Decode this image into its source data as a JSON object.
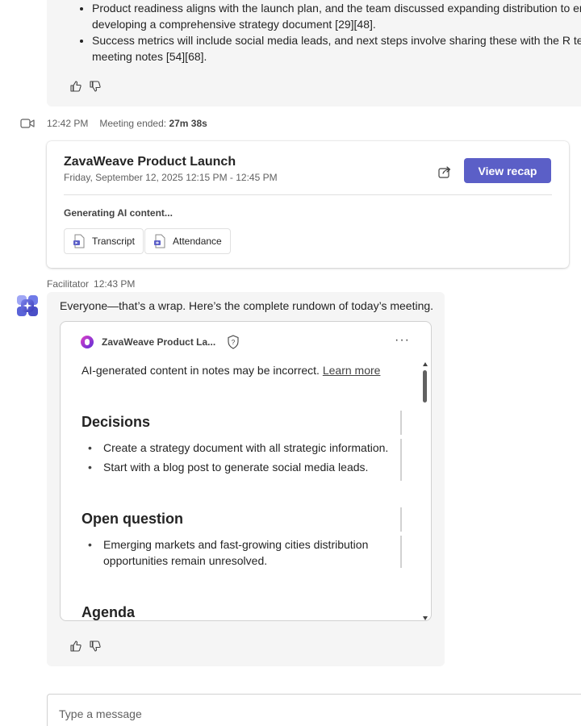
{
  "top_message": {
    "bullets": [
      {
        "line1": "Product readiness aligns with the launch plan, and the team discussed expanding distribution to em",
        "line2": "developing a comprehensive strategy document [29][48]."
      },
      {
        "line1": "Success metrics will include social media leads, and next steps involve sharing these with the R team",
        "line2": "meeting notes [54][68]."
      }
    ]
  },
  "meeting_ended": {
    "time": "12:42 PM",
    "label": "Meeting ended:",
    "duration": "27m 38s"
  },
  "meeting_card": {
    "title": "ZavaWeave Product Launch",
    "date": "Friday, September 12, 2025 12:15 PM - 12:45 PM",
    "recap_button": "View recap",
    "generating": "Generating AI content...",
    "chips": [
      "Transcript",
      "Attendance"
    ]
  },
  "facilitator": {
    "name": "Facilitator",
    "time": "12:43 PM",
    "message": "Everyone—that’s a wrap. Here’s the complete rundown of today’s meeting."
  },
  "loop": {
    "title": "ZavaWeave Product La...",
    "disclaimer": "AI-generated content in notes may be incorrect.",
    "learn_more": "Learn more",
    "sections": [
      {
        "heading": "Decisions",
        "items": [
          "Create a strategy document with all strategic information.",
          "Start with a blog post to generate social media leads."
        ]
      },
      {
        "heading": "Open question",
        "items": [
          "Emerging markets and fast-growing cities distribution opportunities remain unresolved."
        ]
      },
      {
        "heading": "Agenda",
        "items": []
      }
    ]
  },
  "compose": {
    "placeholder": "Type a message"
  },
  "colors": {
    "accent": "#5b5fc7",
    "bubble": "#f5f5f5"
  }
}
